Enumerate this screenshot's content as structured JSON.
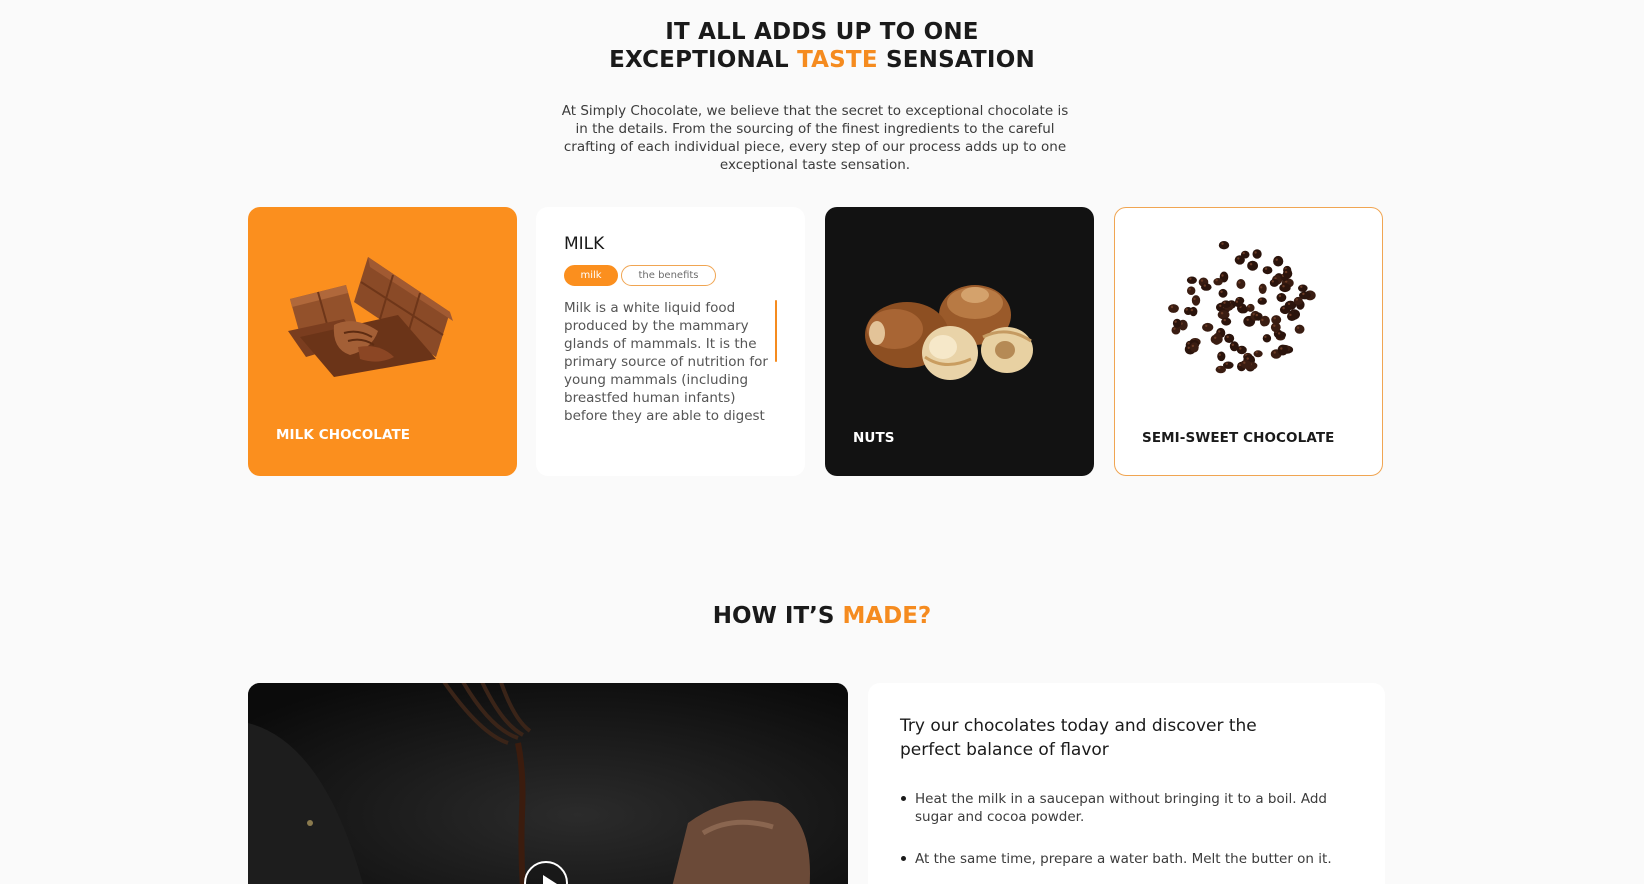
{
  "section1": {
    "title_line1": "IT ALL ADDS UP TO ONE",
    "title_line2_pre": "EXCEPTIONAL ",
    "title_line2_accent": "TASTE",
    "title_line2_post": " SENSATION",
    "intro": "At Simply Chocolate, we believe that the secret to exceptional chocolate is in the details. From the sourcing of the finest ingredients to the careful crafting of each individual piece, every step of our process adds up to one exceptional taste sensation."
  },
  "cards": {
    "milk_chocolate": {
      "label": "MILK CHOCOLATE",
      "icon": "chocolate-bar-icon"
    },
    "milk": {
      "title": "MILK",
      "chips": [
        "milk",
        "the benefits"
      ],
      "text": "Milk is a white liquid food produced by the mammary glands of mammals. It is the primary source of nutrition for young mammals (including breastfed human infants) before they are able to digest"
    },
    "nuts": {
      "label": "NUTS",
      "icon": "hazelnuts-icon"
    },
    "semi_sweet": {
      "label": "SEMI-SWEET CHOCOLATE",
      "icon": "chocolate-chips-icon"
    }
  },
  "section2": {
    "title_pre": "HOW IT’S ",
    "title_accent": "MADE?",
    "recipe_title": "Try our chocolates today and discover the perfect balance of flavor",
    "steps": [
      "Heat the milk in a saucepan without bringing it to a boil. Add sugar and cocoa powder.",
      "At the same time, prepare a water bath. Melt the butter on it."
    ]
  },
  "colors": {
    "accent": "#f58b1f",
    "dark_card": "#121212",
    "background": "#fafafa"
  }
}
